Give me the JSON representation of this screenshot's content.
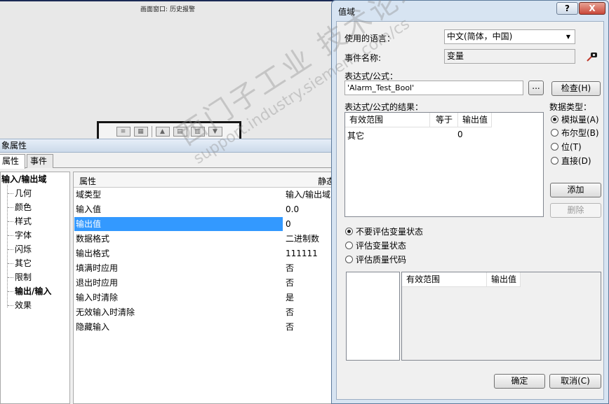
{
  "editor": {
    "screen_title": "画面窗口: 历史报警",
    "props_title": "象属性",
    "tabs": [
      "属性",
      "事件"
    ],
    "tree": [
      "输入/输出域",
      "几何",
      "颜色",
      "样式",
      "字体",
      "闪烁",
      "其它",
      "限制",
      "输出/输入",
      "效果"
    ],
    "grid_headers": [
      "属性",
      "静态"
    ],
    "rows": [
      {
        "k": "域类型",
        "v": "输入/输出域"
      },
      {
        "k": "输入值",
        "v": "0.0"
      },
      {
        "k": "输出值",
        "v": "0"
      },
      {
        "k": "数据格式",
        "v": "二进制数"
      },
      {
        "k": "输出格式",
        "v": "111111"
      },
      {
        "k": "填满时应用",
        "v": "否"
      },
      {
        "k": "退出时应用",
        "v": "否"
      },
      {
        "k": "输入时清除",
        "v": "是"
      },
      {
        "k": "无效输入时清除",
        "v": "否"
      },
      {
        "k": "隐藏输入",
        "v": "否"
      }
    ]
  },
  "dialog": {
    "title": "值域",
    "help": "?",
    "close": "X",
    "lang_label": "使用的语言：",
    "lang_value": "中文(简体，中国)",
    "event_label": "事件名称:",
    "event_value": "变量",
    "expr_label": "表达式/公式：",
    "expr_value": "'Alarm_Test_Bool'",
    "browse": "...",
    "check": "检查(H)",
    "result_label": "表达式/公式的结果：",
    "result_headers": [
      "有效范围",
      "等于",
      "输出值"
    ],
    "result_rows": [
      {
        "range": "其它",
        "equal": "",
        "out": "0"
      }
    ],
    "dtype_label": "数据类型：",
    "dtypes": [
      "模拟量(A)",
      "布尔型(B)",
      "位(T)",
      "直接(D)"
    ],
    "add": "添加",
    "delete": "删除",
    "eval_options": [
      "不要评估变量状态",
      "评估变量状态",
      "评估质量代码"
    ],
    "lower_headers": [
      "有效范围",
      "输出值"
    ],
    "ok": "确定",
    "cancel": "取消(C)"
  },
  "watermark": {
    "line1": "西门子工业 技术论坛",
    "line2": "support.industry.siemens.com/cs"
  },
  "colors": {
    "selection": "#3399ff",
    "dialog_frame": "#d7e4f2",
    "close_button": "#c9483a"
  }
}
